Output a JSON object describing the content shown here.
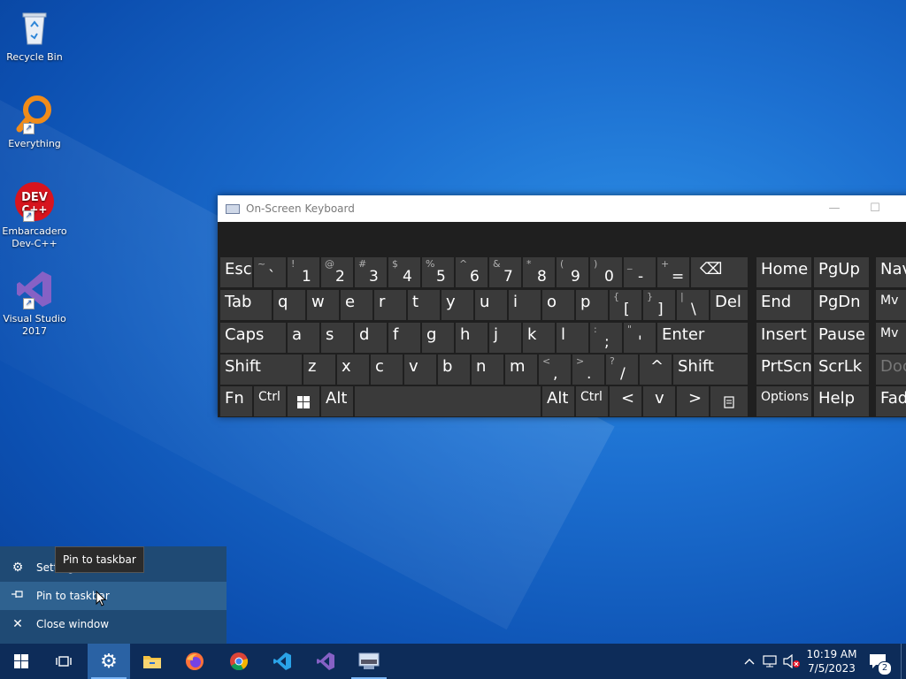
{
  "desktop": {
    "icons": [
      {
        "label": "Recycle Bin"
      },
      {
        "label": "Everything"
      },
      {
        "label": "Embarcadero Dev-C++"
      },
      {
        "label": "Visual Studio 2017"
      }
    ]
  },
  "osk": {
    "title": "On-Screen Keyboard",
    "minimize": "—",
    "maximize": "☐",
    "keys": {
      "esc": "Esc",
      "tab": "Tab",
      "caps": "Caps",
      "shift": "Shift",
      "fn": "Fn",
      "ctrl": "Ctrl",
      "alt": "Alt",
      "del": "Del",
      "enter": "Enter",
      "shift_r": "Shift",
      "alt_r": "Alt",
      "ctrl_r": "Ctrl",
      "backspace": "⌫",
      "num1": {
        "sub": "!",
        "main": "1"
      },
      "num2": {
        "sub": "@",
        "main": "2"
      },
      "num3": {
        "sub": "#",
        "main": "3"
      },
      "num4": {
        "sub": "$",
        "main": "4"
      },
      "num5": {
        "sub": "%",
        "main": "5"
      },
      "num6": {
        "sub": "^",
        "main": "6"
      },
      "num7": {
        "sub": "&",
        "main": "7"
      },
      "num8": {
        "sub": "*",
        "main": "8"
      },
      "num9": {
        "sub": "(",
        "main": "9"
      },
      "num0": {
        "sub": ")",
        "main": "0"
      },
      "minus": {
        "sub": "_",
        "main": "-"
      },
      "equals": {
        "sub": "+",
        "main": "="
      },
      "tilde": {
        "sub": "~",
        "main": "`"
      },
      "lbracket": {
        "sub": "{",
        "main": "["
      },
      "rbracket": {
        "sub": "}",
        "main": "]"
      },
      "backslash": {
        "sub": "|",
        "main": "\\"
      },
      "semicolon": {
        "sub": ":",
        "main": ";"
      },
      "quote": {
        "sub": "\"",
        "main": "'"
      },
      "comma": {
        "sub": "<",
        "main": ","
      },
      "period": {
        "sub": ">",
        "main": "."
      },
      "slash": {
        "sub": "?",
        "main": "/"
      },
      "q": "q",
      "w": "w",
      "e": "e",
      "r": "r",
      "t": "t",
      "y": "y",
      "u": "u",
      "i": "i",
      "o": "o",
      "p": "p",
      "a": "a",
      "s": "s",
      "d": "d",
      "f": "f",
      "g": "g",
      "h": "h",
      "j": "j",
      "k": "k",
      "l": "l",
      "z": "z",
      "x": "x",
      "c": "c",
      "v": "v",
      "b": "b",
      "n": "n",
      "m": "m",
      "up": "^",
      "left": "<",
      "down": "v",
      "right": ">",
      "home": "Home",
      "pgup": "PgUp",
      "nav": "Nav",
      "end": "End",
      "pgdn": "PgDn",
      "mv_up": "Mv",
      "insert": "Insert",
      "pause": "Pause",
      "mv_down": "Mv",
      "prtscn": "PrtScn",
      "scrlk": "ScrLk",
      "dock": "Doc",
      "options": "Options",
      "help": "Help",
      "fade": "Fad"
    }
  },
  "context_menu": {
    "items": [
      {
        "label": "Settings",
        "icon": "gear-icon"
      },
      {
        "label": "Pin to taskbar",
        "icon": "pin-icon"
      },
      {
        "label": "Close window",
        "icon": "close-icon"
      }
    ],
    "tooltip": "Pin to taskbar"
  },
  "taskbar": {
    "clock_time": "10:19 AM",
    "clock_date": "7/5/2023",
    "notification_count": "2"
  },
  "colors": {
    "taskbar": "#0d2c59",
    "active_button": "#2a62a4",
    "context_menu": "#1f4a74",
    "key": "#3a3a3a"
  }
}
